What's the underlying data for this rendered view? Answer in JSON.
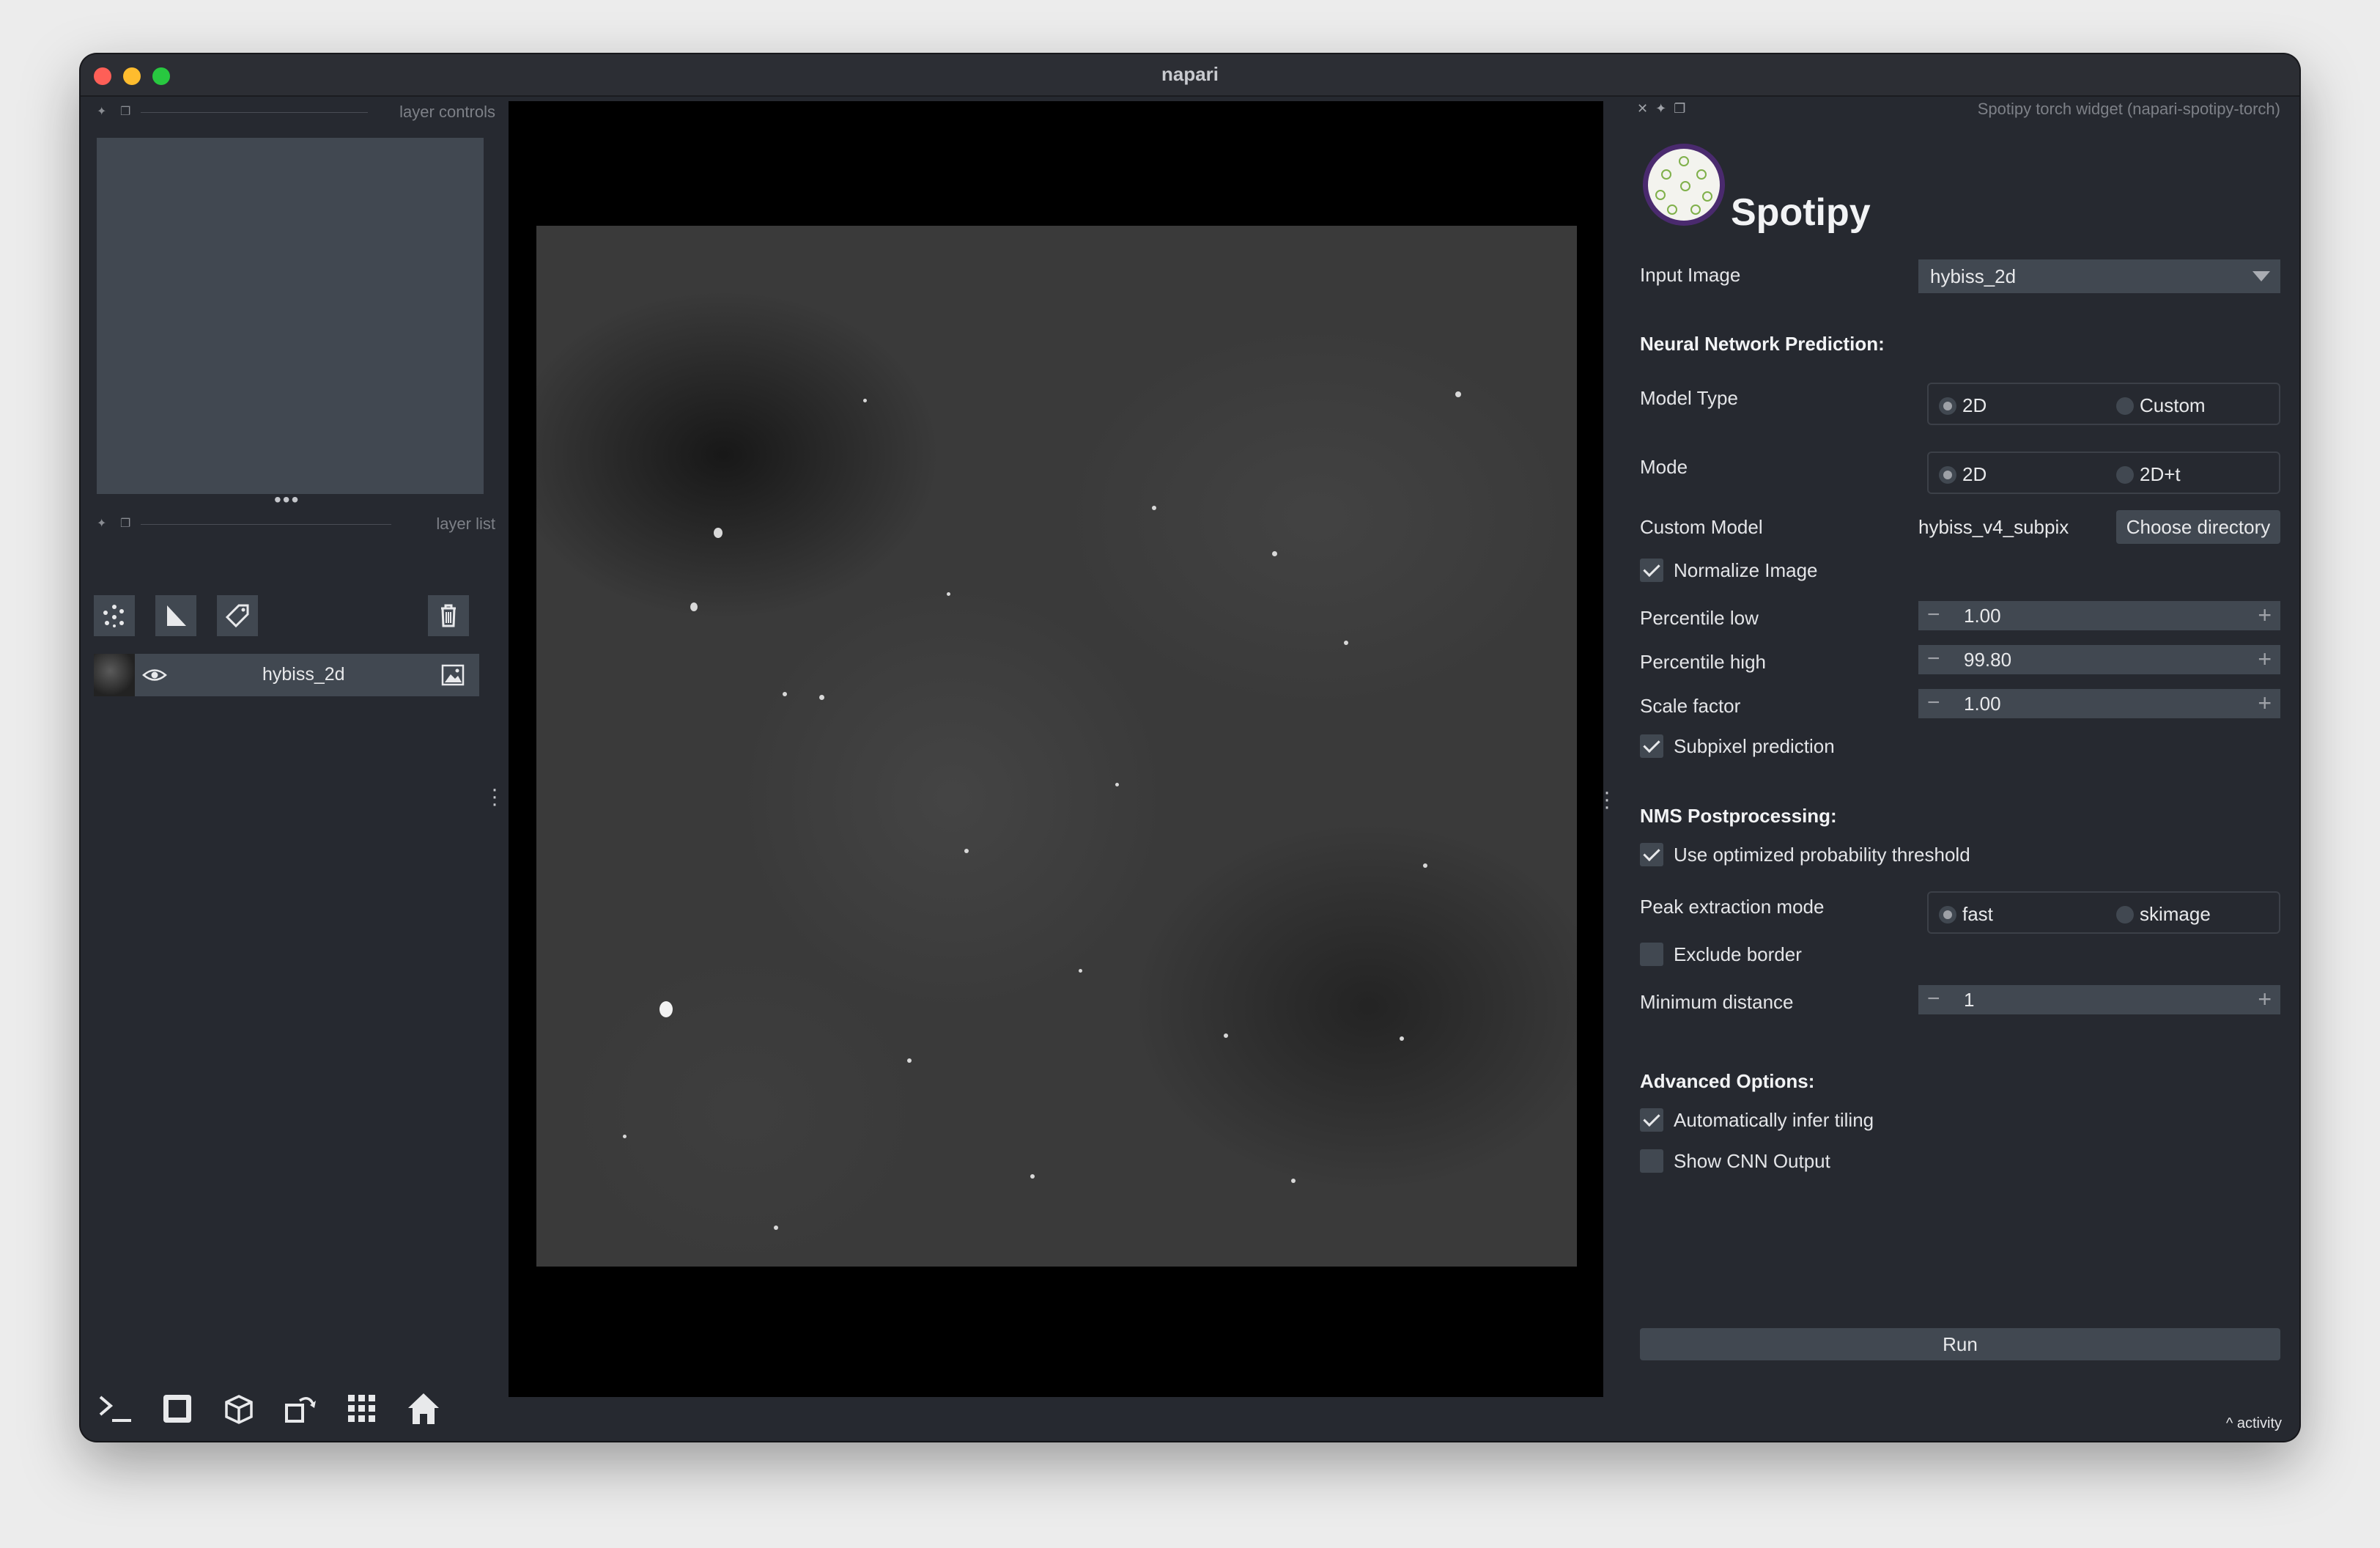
{
  "window": {
    "title": "napari"
  },
  "left_dock": {
    "controls_title": "layer controls",
    "list_title": "layer list",
    "layers": [
      {
        "name": "hybiss_2d"
      }
    ]
  },
  "right_dock": {
    "title": "Spotipy torch widget (napari-spotipy-torch)",
    "app_title": "Spotipy",
    "input_image_label": "Input Image",
    "input_image_value": "hybiss_2d",
    "nn_section": "Neural Network Prediction:",
    "model_type_label": "Model Type",
    "model_type_options": [
      "2D",
      "Custom"
    ],
    "mode_label": "Mode",
    "mode_options": [
      "2D",
      "2D+t"
    ],
    "custom_model_label": "Custom Model",
    "custom_model_value": "hybiss_v4_subpix",
    "choose_directory": "Choose directory",
    "normalize_label": "Normalize Image",
    "percentile_low_label": "Percentile low",
    "percentile_low": "1.00",
    "percentile_high_label": "Percentile high",
    "percentile_high": "99.80",
    "scale_factor_label": "Scale factor",
    "scale_factor": "1.00",
    "subpixel_label": "Subpixel prediction",
    "nms_section": "NMS Postprocessing:",
    "optimized_threshold_label": "Use optimized probability threshold",
    "peak_mode_label": "Peak extraction mode",
    "peak_mode_options": [
      "fast",
      "skimage"
    ],
    "exclude_border_label": "Exclude border",
    "min_distance_label": "Minimum distance",
    "min_distance": "1",
    "advanced_section": "Advanced Options:",
    "infer_tiling_label": "Automatically infer tiling",
    "show_cnn_label": "Show CNN Output",
    "run_label": "Run",
    "activity_label": "activity"
  }
}
